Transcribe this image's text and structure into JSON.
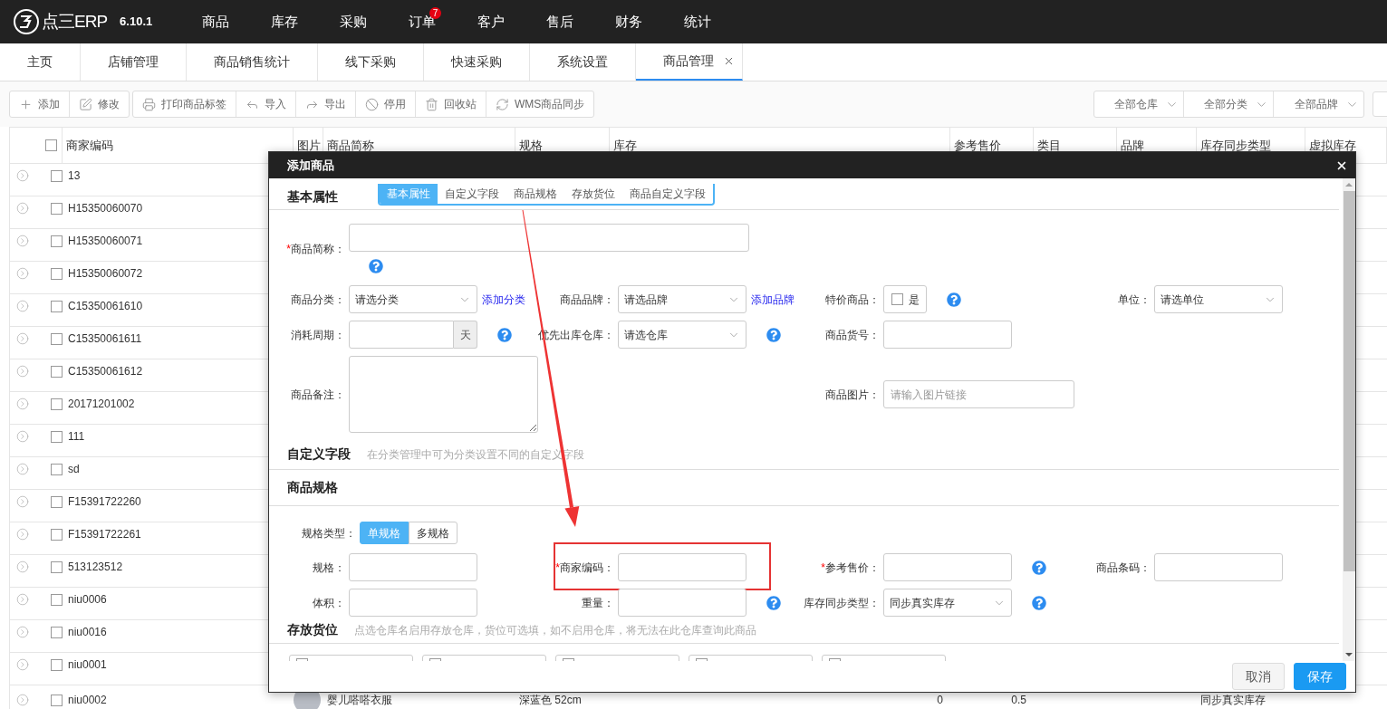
{
  "top_bar": {
    "logo": "点三ERP",
    "version": "6.10.1",
    "menu": [
      {
        "label": "商品"
      },
      {
        "label": "库存"
      },
      {
        "label": "采购"
      },
      {
        "label": "订单",
        "badge": "7"
      },
      {
        "label": "客户"
      },
      {
        "label": "售后"
      },
      {
        "label": "财务"
      },
      {
        "label": "统计"
      }
    ]
  },
  "tabs": [
    {
      "label": "主页",
      "selected": false,
      "closable": false
    },
    {
      "label": "店铺管理",
      "selected": false,
      "closable": false
    },
    {
      "label": "商品销售统计",
      "selected": false,
      "closable": false
    },
    {
      "label": "线下采购",
      "selected": false,
      "closable": false
    },
    {
      "label": "快速采购",
      "selected": false,
      "closable": false
    },
    {
      "label": "系统设置",
      "selected": false,
      "closable": false
    },
    {
      "label": "商品管理",
      "selected": true,
      "closable": true
    }
  ],
  "toolbar": {
    "groups": [
      [
        {
          "label": "添加"
        },
        {
          "label": "修改"
        }
      ],
      [
        {
          "label": "打印商品标签"
        },
        {
          "label": "导入"
        },
        {
          "label": "导出"
        },
        {
          "label": "停用"
        },
        {
          "label": "回收站"
        },
        {
          "label": "WMS商品同步"
        }
      ]
    ],
    "filters": [
      {
        "label": "全部仓库"
      },
      {
        "label": "全部分类"
      },
      {
        "label": "全部品牌"
      }
    ]
  },
  "table": {
    "all_checked": false,
    "columns": [
      "商家编码",
      "图片",
      "商品简称",
      "规格",
      "库存",
      "参考售价",
      "类目",
      "品牌",
      "库存同步类型",
      "虚拟库存"
    ],
    "rows": [
      {
        "code": "13",
        "checked": false
      },
      {
        "code": "H15350060070",
        "checked": false
      },
      {
        "code": "H15350060071",
        "checked": false
      },
      {
        "code": "H15350060072",
        "checked": false
      },
      {
        "code": "C15350061610",
        "checked": false
      },
      {
        "code": "C15350061611",
        "checked": false
      },
      {
        "code": "C15350061612",
        "checked": false
      },
      {
        "code": "20171201002",
        "checked": false
      },
      {
        "code": "111",
        "checked": false
      },
      {
        "code": "sd",
        "checked": false
      },
      {
        "code": "F15391722260",
        "checked": false
      },
      {
        "code": "F15391722261",
        "checked": false
      },
      {
        "code": "513123512",
        "checked": false
      },
      {
        "code": "niu0006",
        "checked": false
      },
      {
        "code": "niu0016",
        "checked": false
      },
      {
        "code": "niu0001",
        "checked": false
      },
      {
        "code": "niu0002",
        "checked": false,
        "image": true,
        "name": "婴儿嗒嗒衣服",
        "spec": "深蓝色 52cm",
        "stock": "0",
        "price": "0.5",
        "sync_type": "同步真实库存"
      }
    ]
  },
  "dialog": {
    "title": "添加商品",
    "basic": {
      "heading": "基本属性",
      "section_tabs": [
        {
          "label": "基本属性",
          "selected": true
        },
        {
          "label": "自定义字段",
          "selected": false
        },
        {
          "label": "商品规格",
          "selected": false
        },
        {
          "label": "存放货位",
          "selected": false
        },
        {
          "label": "商品自定义字段",
          "selected": false
        }
      ],
      "rows": [
        {
          "cells": [
            {
              "kind": "text",
              "label": "商品简称：",
              "required_mark": "*",
              "wide": true,
              "help": true
            }
          ]
        },
        {
          "cells": [
            {
              "kind": "select",
              "label": "商品分类：",
              "value": "请选分类",
              "link": "添加分类"
            },
            {
              "kind": "select",
              "label": "商品品牌：",
              "value": "请选品牌",
              "link": "添加品牌"
            },
            {
              "kind": "checkbox",
              "label": "特价商品：",
              "option": "是",
              "checked": false,
              "help": true
            },
            {
              "kind": "select",
              "label": "单位：",
              "value": "请选单位"
            }
          ]
        },
        {
          "cells": [
            {
              "kind": "addon",
              "label": "消耗周期：",
              "addon": "天",
              "help": true
            },
            {
              "kind": "select",
              "label": "优先出库仓库：",
              "value": "请选仓库",
              "help": true
            },
            {
              "kind": "text",
              "label": "商品货号："
            }
          ]
        },
        {
          "cells": [
            {
              "kind": "textarea",
              "label": "商品备注："
            },
            null,
            {
              "kind": "text",
              "label": "商品图片：",
              "placeholder": "请输入图片链接",
              "wide": true
            }
          ]
        }
      ]
    },
    "custom": {
      "heading": "自定义字段",
      "hint": "在分类管理中可为分类设置不同的自定义字段"
    },
    "spec": {
      "heading": "商品规格",
      "type_label": "规格类型：",
      "types": [
        {
          "label": "单规格",
          "selected": true
        },
        {
          "label": "多规格",
          "selected": false
        }
      ],
      "rows": [
        {
          "cells": [
            {
              "kind": "text",
              "label": "规格："
            },
            {
              "kind": "text",
              "label": "商家编码：",
              "required_mark": "*",
              "annotated": true
            },
            {
              "kind": "text",
              "label": "参考售价：",
              "required_mark": "*",
              "help": true
            },
            {
              "kind": "text",
              "label": "商品条码："
            }
          ]
        },
        {
          "cells": [
            {
              "kind": "text",
              "label": "体积："
            },
            {
              "kind": "text",
              "label": "重量：",
              "help": true
            },
            {
              "kind": "select",
              "label": "库存同步类型：",
              "value": "同步真实库存",
              "help": true
            }
          ]
        }
      ]
    },
    "storage": {
      "heading": "存放货位",
      "hint": "点选仓库名启用存放仓库，货位可选填，如不启用仓库，将无法在此仓库查询此商品",
      "warehouses": [
        {
          "checked": false
        },
        {
          "checked": false
        },
        {
          "checked": false
        },
        {
          "checked": false
        },
        {
          "checked": false
        }
      ]
    },
    "buttons": [
      {
        "label": "取消",
        "kind": "secondary"
      },
      {
        "label": "保存",
        "kind": "primary"
      }
    ]
  }
}
